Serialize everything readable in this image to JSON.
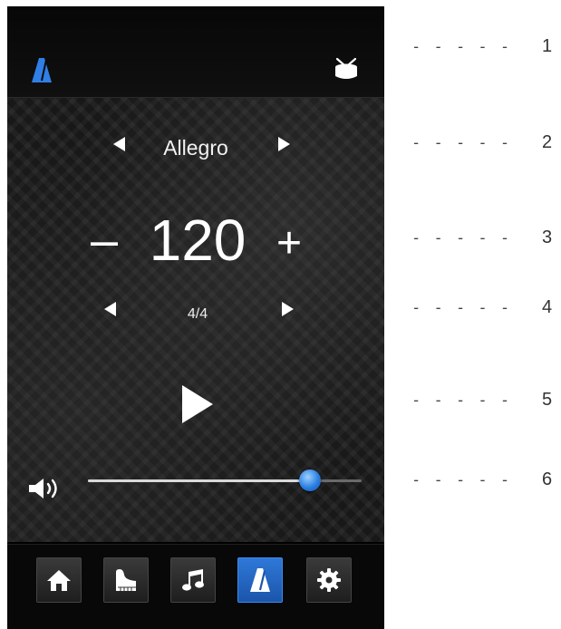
{
  "header": {
    "left_icon": "metronome-icon",
    "right_icon": "drum-icon"
  },
  "tempo": {
    "name": "Allegro",
    "bpm": "120",
    "minus": "–",
    "plus": "+"
  },
  "time_signature": "4/4",
  "volume": {
    "level_fraction": 0.81,
    "icon": "speaker-icon"
  },
  "tabs": [
    {
      "icon": "home-icon",
      "active": false
    },
    {
      "icon": "piano-icon",
      "active": false
    },
    {
      "icon": "music-note-icon",
      "active": false
    },
    {
      "icon": "metronome-icon",
      "active": true
    },
    {
      "icon": "gear-icon",
      "active": false
    }
  ],
  "annotations": {
    "dashes": "- - - - -",
    "labels": [
      "1",
      "2",
      "3",
      "4",
      "5",
      "6"
    ]
  },
  "colors": {
    "accent": "#2a7fe0",
    "background": "#000000"
  }
}
